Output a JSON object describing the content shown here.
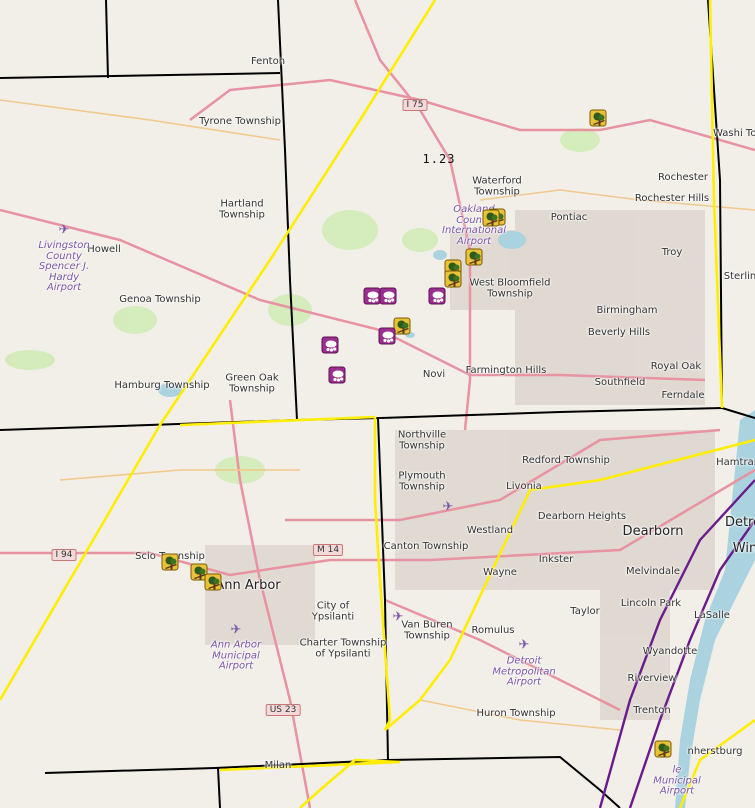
{
  "map": {
    "value_label": "1.23",
    "colors": {
      "county_line": "#000000",
      "yellow_boundary": "#ffee00",
      "purple_boundary": "#6a1b8a",
      "storm_marker": "#e9c23a",
      "hail_marker": "#9b2f8f",
      "road": "#e892a2",
      "water": "#aad3df"
    },
    "places": [
      {
        "id": "fenton",
        "text": "Fenton"
      },
      {
        "id": "tyrone",
        "text": "Tyrone Township"
      },
      {
        "id": "hartland",
        "text": "Hartland Township"
      },
      {
        "id": "howell",
        "text": "Howell"
      },
      {
        "id": "genoa",
        "text": "Genoa Township"
      },
      {
        "id": "hamburg",
        "text": "Hamburg Township"
      },
      {
        "id": "greenoak",
        "text": "Green Oak Township"
      },
      {
        "id": "waterford",
        "text": "Waterford Township"
      },
      {
        "id": "pontiac",
        "text": "Pontiac"
      },
      {
        "id": "rochester",
        "text": "Rochester"
      },
      {
        "id": "rochesterhills",
        "text": "Rochester Hills"
      },
      {
        "id": "washington",
        "text": "Washi Town"
      },
      {
        "id": "troy",
        "text": "Troy"
      },
      {
        "id": "sterling",
        "text": "Sterlin"
      },
      {
        "id": "westbloomfield",
        "text": "West Bloomfield Township"
      },
      {
        "id": "birmingham",
        "text": "Birmingham"
      },
      {
        "id": "beverlyhills",
        "text": "Beverly Hills"
      },
      {
        "id": "royaloak",
        "text": "Royal Oak"
      },
      {
        "id": "southfield",
        "text": "Southfield"
      },
      {
        "id": "ferndale",
        "text": "Ferndale"
      },
      {
        "id": "farmington",
        "text": "Farmington Hills"
      },
      {
        "id": "novi",
        "text": "Novi"
      },
      {
        "id": "northville",
        "text": "Northville Township"
      },
      {
        "id": "plymouth",
        "text": "Plymouth Township"
      },
      {
        "id": "redford",
        "text": "Redford Township"
      },
      {
        "id": "hamtramck",
        "text": "Hamtrar"
      },
      {
        "id": "livonia",
        "text": "Livonia"
      },
      {
        "id": "dearbornheights",
        "text": "Dearborn Heights"
      },
      {
        "id": "dearborn",
        "text": "Dearborn"
      },
      {
        "id": "detroit",
        "text": "Detro"
      },
      {
        "id": "windsor",
        "text": "Win"
      },
      {
        "id": "westland",
        "text": "Westland"
      },
      {
        "id": "canton",
        "text": "Canton Township"
      },
      {
        "id": "inkster",
        "text": "Inkster"
      },
      {
        "id": "melvindale",
        "text": "Melvindale"
      },
      {
        "id": "wayne",
        "text": "Wayne"
      },
      {
        "id": "lincolnpark",
        "text": "Lincoln Park"
      },
      {
        "id": "lasalle",
        "text": "LaSalle"
      },
      {
        "id": "taylor",
        "text": "Taylor"
      },
      {
        "id": "vanburen",
        "text": "Van Buren Township"
      },
      {
        "id": "romulus",
        "text": "Romulus"
      },
      {
        "id": "wyandotte",
        "text": "Wyandotte"
      },
      {
        "id": "riverview",
        "text": "Riverview"
      },
      {
        "id": "trenton",
        "text": "Trenton"
      },
      {
        "id": "huron",
        "text": "Huron Township"
      },
      {
        "id": "amherstburg",
        "text": "nherstburg"
      },
      {
        "id": "scio",
        "text": "Scio Township"
      },
      {
        "id": "annarbor",
        "text": "Ann Arbor"
      },
      {
        "id": "ypsilanti",
        "text": "City of Ypsilanti"
      },
      {
        "id": "charter",
        "text": "Charter Township of Ypsilanti"
      },
      {
        "id": "milan",
        "text": "Milan"
      }
    ],
    "airports": [
      {
        "id": "livingston",
        "text": "Livingston County Spencer J. Hardy Airport"
      },
      {
        "id": "oakland",
        "text": "Oakland County International Airport"
      },
      {
        "id": "annarbor_apt",
        "text": "Ann Arbor Municipal Airport"
      },
      {
        "id": "detroit_apt",
        "text": "Detroit Metropolitan Airport"
      },
      {
        "id": "grosseile",
        "text": "le Municipal Airport"
      }
    ],
    "shields": [
      {
        "id": "i75",
        "text": "I 75"
      },
      {
        "id": "i94",
        "text": "I 94"
      },
      {
        "id": "m14",
        "text": "M 14"
      },
      {
        "id": "us23",
        "text": "US 23"
      }
    ],
    "markers": [
      {
        "kind": "storm"
      },
      {
        "kind": "storm"
      },
      {
        "kind": "storm"
      },
      {
        "kind": "storm"
      },
      {
        "kind": "storm"
      },
      {
        "kind": "storm"
      },
      {
        "kind": "storm"
      },
      {
        "kind": "storm"
      },
      {
        "kind": "storm"
      },
      {
        "kind": "storm"
      },
      {
        "kind": "storm"
      },
      {
        "kind": "hail"
      },
      {
        "kind": "hail"
      },
      {
        "kind": "hail"
      },
      {
        "kind": "hail"
      },
      {
        "kind": "hail"
      },
      {
        "kind": "hail"
      }
    ]
  }
}
